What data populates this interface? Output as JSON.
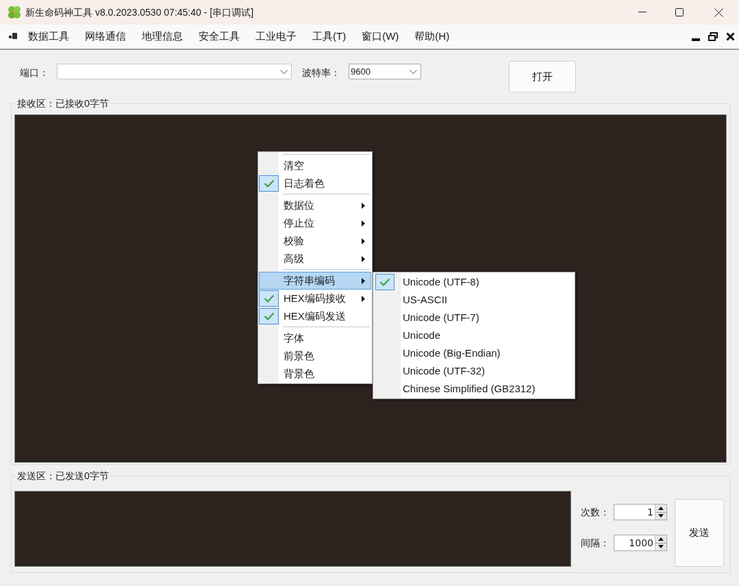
{
  "window": {
    "title": "新生命码神工具 v8.0.2023.0530 07:45:40 - [串口调试]"
  },
  "menu_bar": [
    "数据工具",
    "网络通信",
    "地理信息",
    "安全工具",
    "工业电子",
    "工具(T)",
    "窗口(W)",
    "帮助(H)"
  ],
  "port": {
    "label": "端口："
  },
  "baud_rate": {
    "label": "波特率：",
    "value": "9600"
  },
  "open_button": "打开",
  "receive_area": {
    "title": "接收区：已接收0字节"
  },
  "context_menu": [
    {
      "kind": "separator"
    },
    {
      "kind": "item",
      "label": "清空",
      "checked": false,
      "has_submenu": false,
      "selected": false
    },
    {
      "kind": "item",
      "label": "日志着色",
      "checked": true,
      "has_submenu": false,
      "selected": false
    },
    {
      "kind": "separator"
    },
    {
      "kind": "item",
      "label": "数据位",
      "checked": false,
      "has_submenu": true,
      "selected": false
    },
    {
      "kind": "item",
      "label": "停止位",
      "checked": false,
      "has_submenu": true,
      "selected": false
    },
    {
      "kind": "item",
      "label": "校验",
      "checked": false,
      "has_submenu": true,
      "selected": false
    },
    {
      "kind": "item",
      "label": "高级",
      "checked": false,
      "has_submenu": true,
      "selected": false
    },
    {
      "kind": "separator"
    },
    {
      "kind": "item",
      "label": "字符串编码",
      "checked": false,
      "has_submenu": true,
      "selected": true
    },
    {
      "kind": "item",
      "label": "HEX编码接收",
      "checked": true,
      "has_submenu": true,
      "selected": false
    },
    {
      "kind": "item",
      "label": "HEX编码发送",
      "checked": true,
      "has_submenu": false,
      "selected": false
    },
    {
      "kind": "separator"
    },
    {
      "kind": "item",
      "label": "字体",
      "checked": false,
      "has_submenu": false,
      "selected": false
    },
    {
      "kind": "item",
      "label": "前景色",
      "checked": false,
      "has_submenu": false,
      "selected": false
    },
    {
      "kind": "item",
      "label": "背景色",
      "checked": false,
      "has_submenu": false,
      "selected": false
    }
  ],
  "encoding_submenu": [
    {
      "label": "Unicode (UTF-8)",
      "checked": true
    },
    {
      "label": "US-ASCII",
      "checked": false
    },
    {
      "label": "Unicode (UTF-7)",
      "checked": false
    },
    {
      "label": "Unicode",
      "checked": false
    },
    {
      "label": "Unicode (Big-Endian)",
      "checked": false
    },
    {
      "label": "Unicode (UTF-32)",
      "checked": false
    },
    {
      "label": "Chinese Simplified (GB2312)",
      "checked": false
    }
  ],
  "send_area": {
    "title": "发送区：已发送0字节",
    "count": {
      "label": "次数：",
      "value": "1"
    },
    "interval": {
      "label": "间隔：",
      "value": "1000"
    },
    "send_button": "发送"
  }
}
